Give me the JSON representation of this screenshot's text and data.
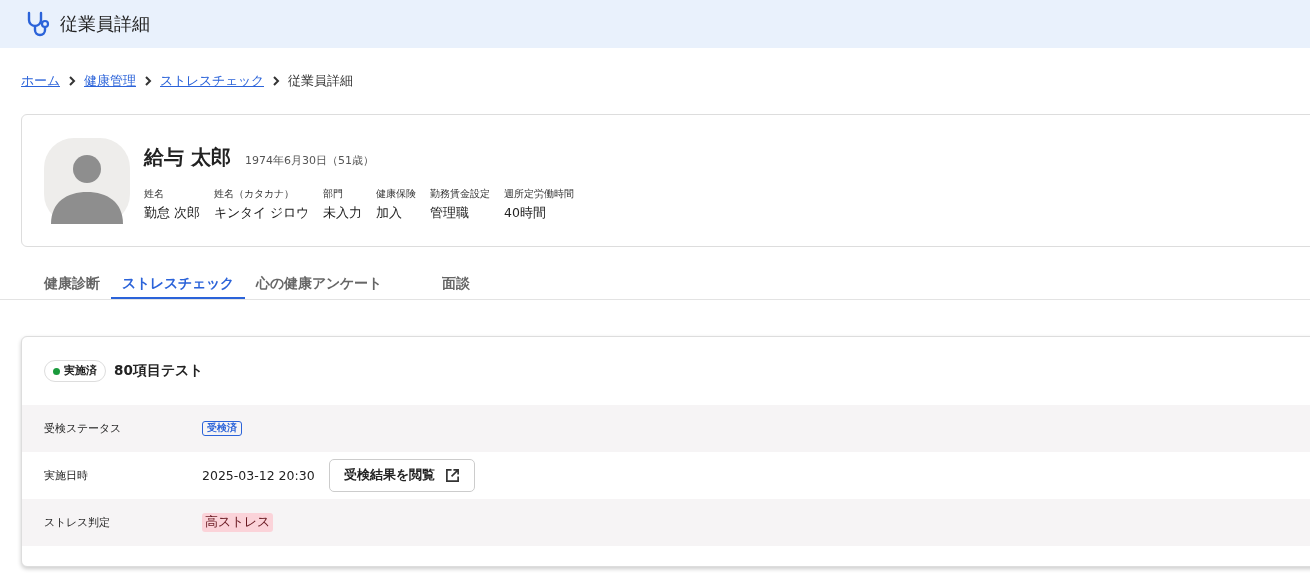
{
  "header": {
    "title": "従業員詳細"
  },
  "breadcrumbs": [
    {
      "label": "ホーム",
      "current": false
    },
    {
      "label": "健康管理",
      "current": false
    },
    {
      "label": "ストレスチェック",
      "current": false
    },
    {
      "label": "従業員詳細",
      "current": true
    }
  ],
  "profile": {
    "name": "給与 太郎",
    "birth": "1974年6月30日（51歳）",
    "fields": [
      {
        "label": "姓名",
        "value": "勤怠 次郎"
      },
      {
        "label": "姓名（カタカナ）",
        "value": "キンタイ ジロウ"
      },
      {
        "label": "部門",
        "value": "未入力"
      },
      {
        "label": "健康保険",
        "value": "加入"
      },
      {
        "label": "勤務賃金設定",
        "value": "管理職"
      },
      {
        "label": "週所定労働時間",
        "value": "40時間"
      }
    ]
  },
  "tabs": [
    {
      "label": "健康診断",
      "selected": false
    },
    {
      "label": "ストレスチェック",
      "selected": true
    },
    {
      "label": "心の健康アンケート",
      "selected": false
    },
    {
      "label": "面談",
      "selected": false
    }
  ],
  "test": {
    "status": {
      "label": "実施済",
      "color": "#1a9a3c"
    },
    "title": "80項目テスト",
    "rows": [
      {
        "kind": "badge",
        "label": "受検ステータス",
        "value": "受検済"
      },
      {
        "kind": "datetime",
        "label": "実施日時",
        "value": "2025-03-12 20:30",
        "button": "受検結果を閲覧"
      },
      {
        "kind": "alert",
        "label": "ストレス判定",
        "value": "高ストレス"
      }
    ]
  }
}
